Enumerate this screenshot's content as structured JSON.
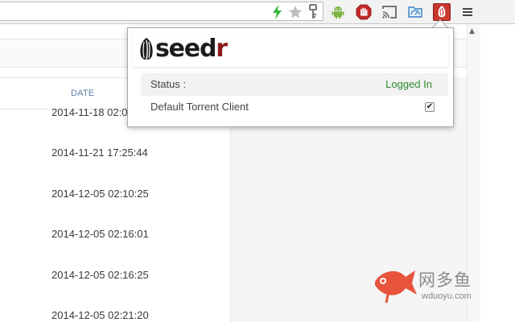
{
  "toolbar": {
    "icons": [
      "bolt-icon",
      "star-icon",
      "key-icon",
      "android-icon",
      "adblock-icon",
      "cast-icon",
      "folder-icon",
      "seedr-extension-icon",
      "menu-icon"
    ]
  },
  "table": {
    "date_header": "DATE",
    "dates": [
      "2014-11-18 02:0",
      "2014-11-21 17:25:44",
      "2014-12-05 02:10:25",
      "2014-12-05 02:16:01",
      "2014-12-05 02:16:25",
      "2014-12-05 02:21:20"
    ]
  },
  "popup": {
    "logo_main": "seed",
    "logo_accent": "r",
    "status_label": "Status :",
    "status_value": "Logged In",
    "status_color": "#2e8b2e",
    "client_label": "Default Torrent Client",
    "client_checked": true,
    "check_mark": "✔"
  },
  "watermark": {
    "title": "网多鱼",
    "url": "wduoyu.com"
  },
  "colors": {
    "accent": "#8e1a1a",
    "seedr_button": "#c7382f",
    "watermark_fish": "#e8533c"
  }
}
